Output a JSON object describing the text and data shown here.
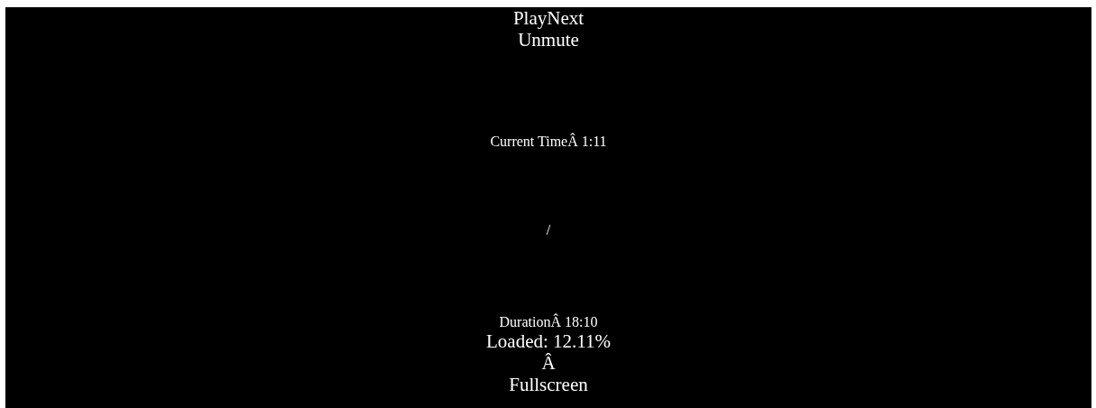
{
  "player_controls": {
    "play_button": {
      "label": "Play"
    },
    "next_button": {
      "label": "Next"
    },
    "mute_button": {
      "label": "Unmute"
    },
    "current_time": "Current TimeÂ 1:11",
    "time_divider": "/",
    "duration": "DurationÂ 18:10",
    "loaded": "Loaded: 12.11%",
    "stray_character": "Â",
    "fullscreen_button": {
      "label": "Fullscreen"
    }
  }
}
